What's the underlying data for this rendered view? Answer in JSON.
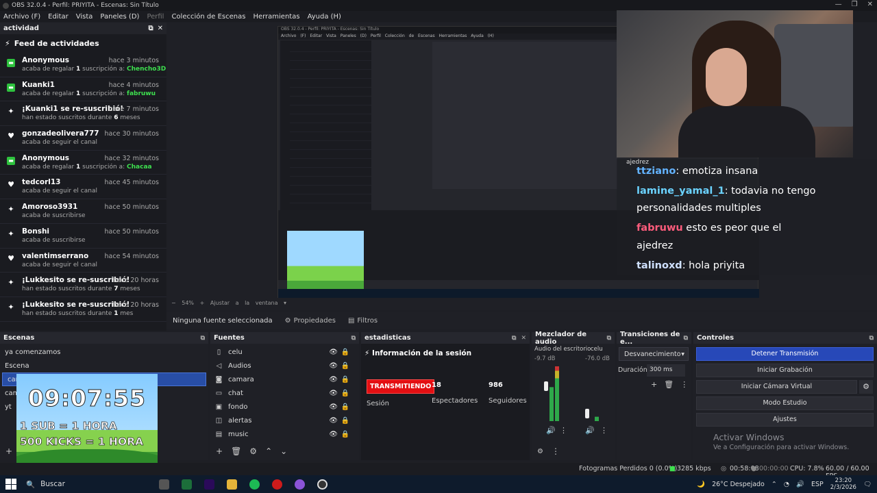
{
  "window": {
    "title": "OBS 32.0.4 - Perfil: PRIYITA - Escenas: Sin Título"
  },
  "menu": [
    "Archivo (F)",
    "Editar",
    "Vista",
    "Paneles (D)",
    "Perfil",
    "Colección de Escenas",
    "Herramientas",
    "Ayuda (H)"
  ],
  "feed": {
    "dock_title": "actividad",
    "title": "Feed de actividades",
    "events": [
      {
        "icon": "gift-icon",
        "name": "Anonymous",
        "time": "hace 3 minutos",
        "sub_pre": "acaba de regalar ",
        "sub_bold": "1",
        "sub_mid": " suscripción a: ",
        "sub_green": "Chencho3D"
      },
      {
        "icon": "gift-icon",
        "name": "Kuanki1",
        "time": "hace 4 minutos",
        "sub_pre": "acaba de regalar ",
        "sub_bold": "1",
        "sub_mid": " suscripción a: ",
        "sub_green": "fabruwu"
      },
      {
        "icon": "star-icon",
        "name": "¡Kuanki1 se re-suscribió!",
        "time": "hace 7 minutos",
        "sub_pre": "han estado suscritos durante ",
        "sub_bold": "6",
        "sub_mid": " meses",
        "sub_green": ""
      },
      {
        "icon": "heart-icon",
        "name": "gonzadeolivera777",
        "time": "hace 30 minutos",
        "sub_pre": "acaba de seguir el canal",
        "sub_bold": "",
        "sub_mid": "",
        "sub_green": ""
      },
      {
        "icon": "gift-icon",
        "name": "Anonymous",
        "time": "hace 32 minutos",
        "sub_pre": "acaba de regalar ",
        "sub_bold": "1",
        "sub_mid": " suscripción a: ",
        "sub_green": "Chacaa"
      },
      {
        "icon": "heart-icon",
        "name": "tedcorl13",
        "time": "hace 45 minutos",
        "sub_pre": "acaba de seguir el canal",
        "sub_bold": "",
        "sub_mid": "",
        "sub_green": ""
      },
      {
        "icon": "star-icon",
        "name": "Amoroso3931",
        "time": "hace 50 minutos",
        "sub_pre": "acaba de suscribirse",
        "sub_bold": "",
        "sub_mid": "",
        "sub_green": ""
      },
      {
        "icon": "star-icon",
        "name": "Bonshi",
        "time": "hace 50 minutos",
        "sub_pre": "acaba de suscribirse",
        "sub_bold": "",
        "sub_mid": "",
        "sub_green": ""
      },
      {
        "icon": "heart-icon",
        "name": "valentimserrano",
        "time": "hace 54 minutos",
        "sub_pre": "acaba de seguir el canal",
        "sub_bold": "",
        "sub_mid": "",
        "sub_green": ""
      },
      {
        "icon": "star-icon",
        "name": "¡Lukkesito se re-suscribió!",
        "time": "hace 20 horas",
        "sub_pre": "han estado suscritos durante ",
        "sub_bold": "7",
        "sub_mid": " meses",
        "sub_green": ""
      },
      {
        "icon": "star-icon",
        "name": "¡Lukkesito se re-suscribió!",
        "time": "hace 20 horas",
        "sub_pre": "han estado suscritos durante ",
        "sub_bold": "1",
        "sub_mid": " mes",
        "sub_green": ""
      }
    ]
  },
  "preview": {
    "zoom": "54%",
    "zoom_mode": "Ajustar a la ventana",
    "chat": [
      {
        "user": "ajedrez",
        "text": ""
      },
      {
        "user": "ttziano",
        "text": ": emotiza insana"
      },
      {
        "user": "lamine_yamal_1",
        "text": ": todavia no tengo"
      },
      {
        "user": "",
        "text": "personalidades multiples"
      },
      {
        "user": "fabruwu",
        "text": "esto es peor que el"
      },
      {
        "user": "",
        "text": "ajedrez"
      },
      {
        "user": "talinoxd",
        "text": ": hola priyita"
      }
    ]
  },
  "source_bar": {
    "none_selected": "Ninguna fuente seleccionada",
    "properties": "Propiedades",
    "filters": "Filtros"
  },
  "scenes": {
    "title": "Escenas",
    "items": [
      "ya comenzamos",
      "Escena",
      "camara",
      "camara 2",
      "yt"
    ]
  },
  "timer": {
    "time": "09:07:55",
    "line1": "1 SUB = 1 HORA",
    "line2": "500 KICKS = 1 HORA"
  },
  "sources": {
    "title": "Fuentes",
    "items": [
      {
        "icon": "phone-icon",
        "name": "celu"
      },
      {
        "icon": "speaker-icon",
        "name": "Audios"
      },
      {
        "icon": "camera-icon",
        "name": "camara"
      },
      {
        "icon": "chat-icon",
        "name": "chat"
      },
      {
        "icon": "image-icon",
        "name": "fondo"
      },
      {
        "icon": "alert-icon",
        "name": "alertas"
      },
      {
        "icon": "music-icon",
        "name": "music"
      }
    ]
  },
  "stats": {
    "title": "estadisticas",
    "session_info": "Información de la sesión",
    "live_badge": "TRANSMITIENDO",
    "session_label": "Sesión",
    "viewers": "18",
    "viewers_label": "Espectadores",
    "followers": "986",
    "followers_label": "Seguidores"
  },
  "mixer": {
    "title": "Mezclador de audio",
    "ch1_name": "Audio del escritorio",
    "ch1_db": "-9.7 dB",
    "ch2_name": "celu",
    "ch2_db": "-76.0 dB",
    "ch1_level": 0.62,
    "ch2_level": 0.08
  },
  "transitions": {
    "title": "Transiciones de e...",
    "selected": "Desvanecimiento",
    "duration_label": "Duración",
    "duration_value": "300 ms"
  },
  "controls": {
    "title": "Controles",
    "buttons": [
      "Detener Transmisión",
      "Iniciar Grabación",
      "Iniciar Cámara Virtual",
      "Modo Estudio",
      "Ajustes"
    ]
  },
  "watermark": {
    "line1": "Activar Windows",
    "line2": "Ve a Configuración para activar Windows."
  },
  "status": {
    "dropped": "Fotogramas Perdidos 0 (0.0%)",
    "bitrate": "3285 kbps",
    "stream_time": "00:58:08",
    "rec_time": "00:00:00",
    "cpu": "CPU: 7.8%",
    "fps": "60.00 / 60.00 FPS"
  },
  "taskbar": {
    "search": "Buscar",
    "weather": "26°C  Despejado",
    "lang": "ESP",
    "time": "23:20",
    "date": "2/3/2026"
  }
}
